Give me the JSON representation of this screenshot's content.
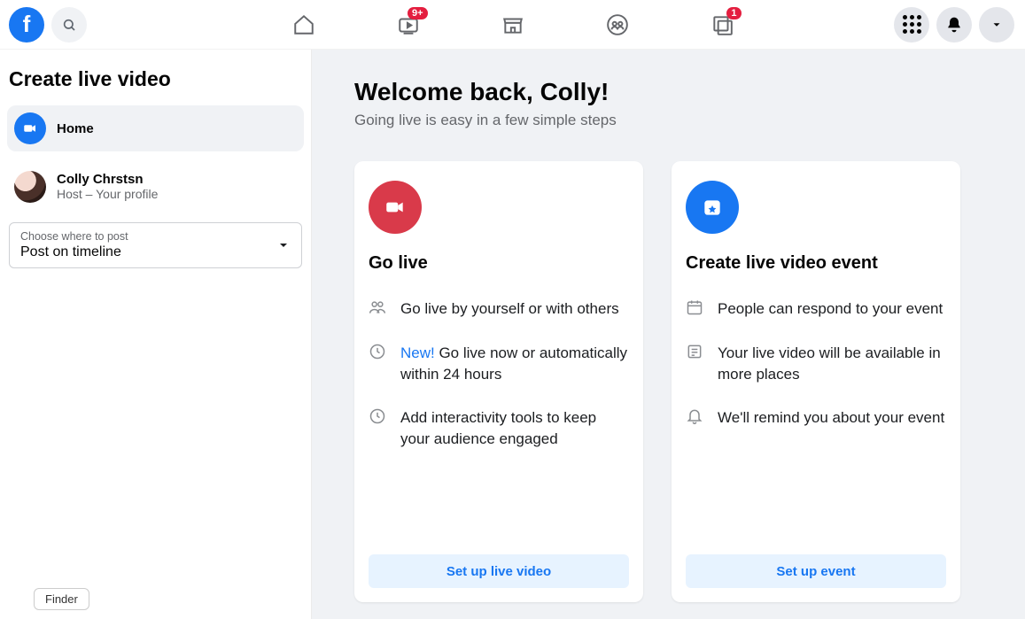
{
  "nav": {
    "watch_badge": "9+",
    "ad_badge": "1"
  },
  "sidebar": {
    "title": "Create live video",
    "home_label": "Home",
    "user": {
      "name": "Colly Chrstsn",
      "role": "Host – Your profile"
    },
    "dropdown": {
      "label": "Choose where to post",
      "value": "Post on timeline"
    }
  },
  "main": {
    "welcome": "Welcome back, Colly!",
    "subtitle": "Going live is easy in a few simple steps"
  },
  "cards": {
    "go_live": {
      "title": "Go live",
      "f1": "Go live by yourself or with others",
      "f2_new": "New!",
      "f2_rest": " Go live now or automatically within 24 hours",
      "f3": "Add interactivity tools to keep your audience engaged",
      "cta": "Set up live video"
    },
    "event": {
      "title": "Create live video event",
      "f1": "People can respond to your event",
      "f2": "Your live video will be available in more places",
      "f3": "We'll remind you about your event",
      "cta": "Set up event"
    }
  },
  "misc": {
    "finder": "Finder"
  }
}
